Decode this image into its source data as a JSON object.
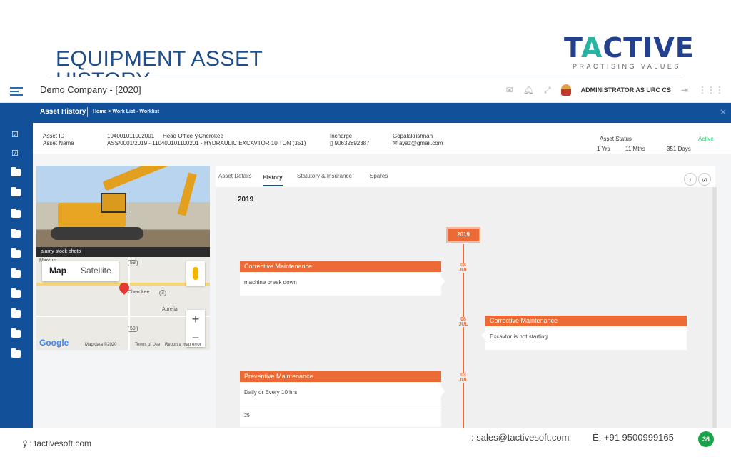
{
  "slide": {
    "title": "EQUIPMENT ASSET",
    "title_cut": "HISTORY",
    "logo_main_1": "T",
    "logo_main_a": "A",
    "logo_main_2": "CTIVE",
    "logo_sub": "PRACTISING VALUES",
    "footer_web": "ý : tactivesoft.com",
    "footer_email": ": sales@tactivesoft.com",
    "footer_phone": "È: +91 9500999165",
    "page_number": "36"
  },
  "topbar": {
    "company": "Demo Company - [2020]",
    "user": "ADMINISTRATOR AS URC CS"
  },
  "header": {
    "title": "Asset History",
    "crumb_home": "Home",
    "crumb_sep": ">",
    "crumb_path": "Work List - Worklist"
  },
  "info": {
    "asset_id_label": "Asset ID",
    "asset_name_label": "Asset Name",
    "asset_id": "104001011002001",
    "location": "Head Office",
    "location2": "Cherokee",
    "asset_name": "ASS/0001/2019 - 110400101100201 - HYDRAULIC EXCAVTOR 10 TON (351)",
    "incharge_label": "Incharge",
    "phone": "90632892387",
    "incharge_name": "Gopalakrishnan",
    "email": "ayaz@gmail.com",
    "status_label": "Asset Status",
    "status": "Active",
    "age_years": "1 Yrs",
    "age_months": "11 Mths",
    "age_days": "351 Days"
  },
  "photo": {
    "watermark": "alamy stock photo"
  },
  "map": {
    "map_btn": "Map",
    "satellite_btn": "Satellite",
    "place1": "Marcus",
    "place2": "Cherokee",
    "place3": "Aurelia",
    "route1": "59",
    "route2": "3",
    "route3": "59",
    "zoom_in": "+",
    "zoom_out": "−",
    "google": "Google",
    "data": "Map data ©2020",
    "terms": "Terms of Use",
    "report": "Report a map error"
  },
  "tabs": [
    {
      "label": "Asset Details"
    },
    {
      "label": "History"
    },
    {
      "label": "Statutory & Insurance"
    },
    {
      "label": "Spares"
    }
  ],
  "timeline": {
    "year_heading": "2019",
    "year_badge": "2019",
    "entries": [
      {
        "day": "08",
        "month": "JUL",
        "type": "Corrective Maintenance",
        "text": "machine break down",
        "extra": ""
      },
      {
        "day": "08",
        "month": "JUL",
        "type": "Corrective Maintenance",
        "text": "Excavtor is not starting",
        "extra": ""
      },
      {
        "day": "03",
        "month": "JUL",
        "type": "Preventive Maintenance",
        "text": "Daily or Every 10 hrs",
        "extra": "25"
      }
    ]
  },
  "colors": {
    "primary": "#12509a",
    "accent": "#ec6a35",
    "status_active": "#2ecc71"
  }
}
